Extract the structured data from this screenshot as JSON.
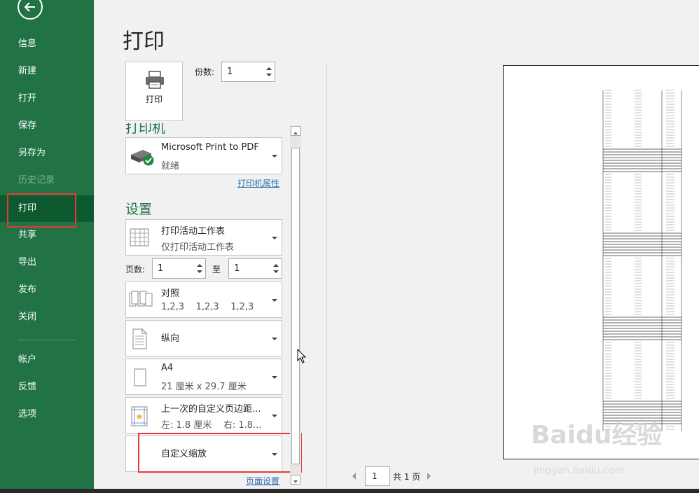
{
  "sidebar": {
    "items": [
      {
        "label": "信息",
        "name": "sidebar-item-info",
        "state": "normal"
      },
      {
        "label": "新建",
        "name": "sidebar-item-new",
        "state": "normal"
      },
      {
        "label": "打开",
        "name": "sidebar-item-open",
        "state": "normal"
      },
      {
        "label": "保存",
        "name": "sidebar-item-save",
        "state": "normal"
      },
      {
        "label": "另存为",
        "name": "sidebar-item-save-as",
        "state": "normal"
      },
      {
        "label": "历史记录",
        "name": "sidebar-item-history",
        "state": "disabled"
      },
      {
        "label": "打印",
        "name": "sidebar-item-print",
        "state": "active"
      },
      {
        "label": "共享",
        "name": "sidebar-item-share",
        "state": "normal"
      },
      {
        "label": "导出",
        "name": "sidebar-item-export",
        "state": "normal"
      },
      {
        "label": "发布",
        "name": "sidebar-item-publish",
        "state": "normal"
      },
      {
        "label": "关闭",
        "name": "sidebar-item-close",
        "state": "normal"
      },
      {
        "label": "帐户",
        "name": "sidebar-item-account",
        "state": "normal"
      },
      {
        "label": "反馈",
        "name": "sidebar-item-feedback",
        "state": "normal"
      },
      {
        "label": "选项",
        "name": "sidebar-item-options",
        "state": "normal"
      }
    ]
  },
  "main": {
    "title": "打印",
    "print_button_label": "打印",
    "copies_label": "份数:",
    "copies_value": "1",
    "printer_section_title": "打印机",
    "printer": {
      "name": "Microsoft Print to PDF",
      "status": "就绪"
    },
    "printer_properties_link": "打印机属性",
    "settings_section_title": "设置",
    "print_what": {
      "line1": "打印活动工作表",
      "line2": "仅打印活动工作表"
    },
    "pages_label": "页数:",
    "pages_from": "1",
    "pages_to_label": "至",
    "pages_to": "1",
    "collate": {
      "line1": "对照",
      "line2": "1,2,3    1,2,3    1,2,3"
    },
    "orientation": {
      "line1": "纵向"
    },
    "paper_size": {
      "line1": "A4",
      "line2": "21 厘米 x 29.7 厘米"
    },
    "margins": {
      "line1": "上一次的自定义页边距...",
      "line2": "左: 1.8 厘米    右: 1.8..."
    },
    "scaling": {
      "line1": "自定义缩放"
    },
    "page_setup_link": "页面设置"
  },
  "preview": {
    "current_page": "1",
    "total_pages": "共 1 页"
  },
  "watermark": {
    "main": "Baidu经验",
    "sub": "jingyan.baidu.com"
  },
  "colors": {
    "accent": "#217346",
    "highlight": "#e53935",
    "link": "#2e6fb3"
  }
}
